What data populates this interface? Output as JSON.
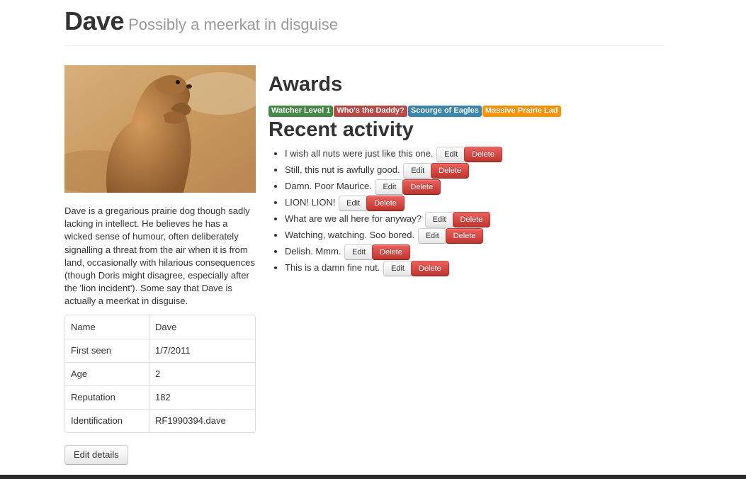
{
  "profile": {
    "name": "Dave",
    "tagline": "Possibly a meerkat in disguise",
    "bio": "Dave is a gregarious prairie dog though sadly lacking in intellect. He believes he has a wicked sense of humour, often deliberately signalling a threat from the air when it is from land, occasionally with hilarious consequences (though Doris might disagree, especially after the 'lion incident'). Some say that Dave is actually a meerkat in disguise.",
    "details": [
      {
        "label": "Name",
        "value": "Dave"
      },
      {
        "label": "First seen",
        "value": "1/7/2011"
      },
      {
        "label": "Age",
        "value": "2"
      },
      {
        "label": "Reputation",
        "value": "182"
      },
      {
        "label": "Identification",
        "value": "RF1990394.dave"
      }
    ],
    "edit_details_label": "Edit details"
  },
  "awards": {
    "title": "Awards",
    "items": [
      {
        "label": "Watcher Level 1",
        "color": "#468847"
      },
      {
        "label": "Who's the Daddy?",
        "color": "#b94a48"
      },
      {
        "label": "Scourge of Eagles",
        "color": "#3a87ad"
      },
      {
        "label": "Massive Prairie Lad",
        "color": "#f89406"
      }
    ]
  },
  "recent": {
    "title": "Recent activity",
    "edit_label": "Edit",
    "delete_label": "Delete",
    "items": [
      "I wish all nuts were just like this one.",
      "Still, this nut is awfully good.",
      "Damn. Poor Maurice.",
      "LION! LION!",
      "What are we all here for anyway?",
      "Watching, watching. Soo bored.",
      "Delish. Mmm.",
      "This is a damn fine nut."
    ]
  }
}
